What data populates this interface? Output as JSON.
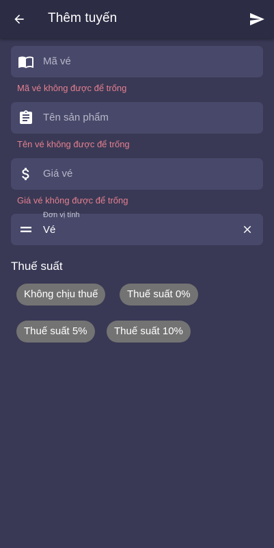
{
  "appbar": {
    "back_icon": "arrow-left-icon",
    "title": "Thêm tuyến",
    "send_icon": "send-icon"
  },
  "fields": [
    {
      "icon": "book-icon",
      "placeholder": "Mã vé",
      "error": "Mã vé không được để trống"
    },
    {
      "icon": "clipboard-icon",
      "placeholder": "Tên sản phẩm",
      "error": "Tên vé không được để trống"
    },
    {
      "icon": "dollar-icon",
      "placeholder": "Giá vé",
      "error": "Giá vé không được để trống"
    },
    {
      "icon": "equal-icon",
      "label": "Đơn vị tính",
      "value": "Vé",
      "clear_icon": "close-icon"
    }
  ],
  "tax": {
    "label": "Thuế suất",
    "options": [
      "Không chịu thuế",
      "Thuế suất 0%",
      "Thuế suất 5%",
      "Thuế suất 10%"
    ]
  },
  "colors": {
    "background": "#393955",
    "appbar": "#2c2c45",
    "field": "#48486a",
    "error": "#e57f8f",
    "chip": "#737373"
  }
}
